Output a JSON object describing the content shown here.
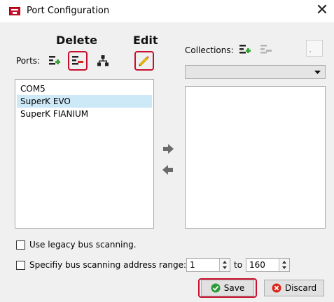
{
  "window": {
    "title": "Port Configuration",
    "close_glyph": "✕"
  },
  "annotations": {
    "delete": "Delete",
    "edit": "Edit"
  },
  "ports": {
    "label": "Ports:",
    "items": [
      "COM5",
      "SuperK EVO",
      "SuperK FIANIUM"
    ],
    "selected_index": 1
  },
  "collections": {
    "label": "Collections:",
    "dropdown_value": ""
  },
  "options": {
    "legacy_label": "Use legacy bus scanning.",
    "legacy_checked": false,
    "range_label": "Specifiy bus scanning address range:",
    "range_checked": false,
    "from_value": "1",
    "to_label": "to",
    "to_value": "160"
  },
  "buttons": {
    "save": "Save",
    "discard": "Discard"
  },
  "colors": {
    "highlight": "#c8102e",
    "add_green": "#3aa63a",
    "remove_red": "#d9261c",
    "selection": "#cde8f7"
  }
}
